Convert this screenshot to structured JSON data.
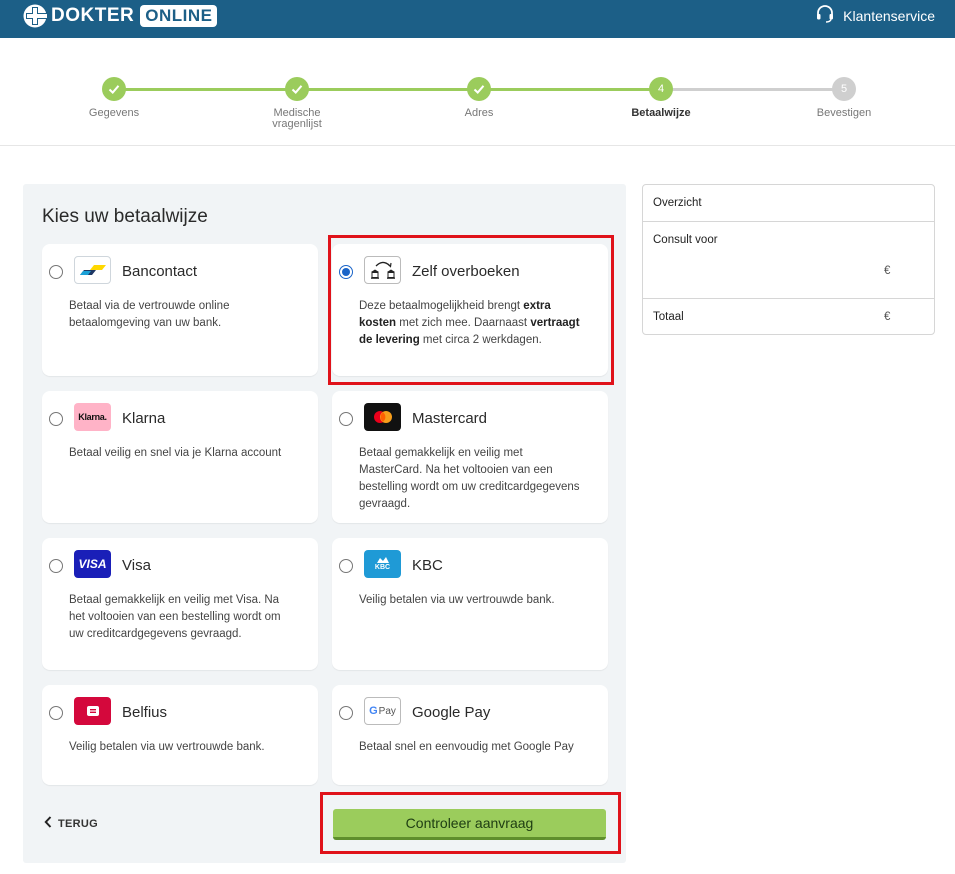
{
  "header": {
    "logo_part1": "DOKTER",
    "logo_part2": "ONLINE",
    "service_label": "Klantenservice"
  },
  "stepper": {
    "steps": [
      {
        "label": "Gegevens",
        "state": "done"
      },
      {
        "label": "Medische\nvragenlijst",
        "state": "done"
      },
      {
        "label": "Adres",
        "state": "done"
      },
      {
        "label": "Betaalwijze",
        "number": "4",
        "state": "active"
      },
      {
        "label": "Bevestigen",
        "number": "5",
        "state": "todo"
      }
    ],
    "colors": {
      "done": "#9bcc5c",
      "todo": "#cfcfcf"
    }
  },
  "payment": {
    "title": "Kies uw betaalwijze",
    "methods": [
      {
        "name": "Bancontact",
        "desc": "Betaal via de vertrouwde online betaalomgeving van uw bank.",
        "icon": "bancontact-logo",
        "selected": false
      },
      {
        "name": "Zelf overboeken",
        "desc_parts": [
          "Deze betaalmogelijkheid brengt ",
          "extra kosten",
          " met zich mee. Daarnaast ",
          "vertraagt de levering",
          " met circa 2 werkdagen."
        ],
        "icon": "bank-transfer-icon",
        "selected": true
      },
      {
        "name": "Klarna",
        "desc": "Betaal veilig en snel via je Klarna account",
        "icon": "klarna-logo",
        "logo_text": "Klarna.",
        "selected": false
      },
      {
        "name": "Mastercard",
        "desc": "Betaal gemakkelijk en veilig met MasterCard. Na het voltooien van een bestelling wordt om uw creditcardgegevens gevraagd.",
        "icon": "mastercard-logo",
        "selected": false
      },
      {
        "name": "Visa",
        "desc": "Betaal gemakkelijk en veilig met Visa. Na het voltooien van een bestelling wordt om uw creditcardgegevens gevraagd.",
        "icon": "visa-logo",
        "logo_text": "VISA",
        "selected": false
      },
      {
        "name": "KBC",
        "desc": "Veilig betalen via uw vertrouwde bank.",
        "icon": "kbc-logo",
        "logo_text": "KBC",
        "selected": false
      },
      {
        "name": "Belfius",
        "desc": "Veilig betalen via uw vertrouwde bank.",
        "icon": "belfius-logo",
        "selected": false
      },
      {
        "name": "Google Pay",
        "desc": "Betaal snel en eenvoudig met Google Pay",
        "icon": "google-pay-logo",
        "logo_text": "Pay",
        "selected": false
      }
    ],
    "back_label": "TERUG",
    "submit_label": "Controleer aanvraag"
  },
  "summary": {
    "title": "Overzicht",
    "consult_label": "Consult voor",
    "consult_value": "€",
    "total_label": "Totaal",
    "total_value": "€"
  },
  "colors": {
    "header_bg": "#1c5f87",
    "accent_green": "#9bcc5c",
    "highlight_red": "#e0121a",
    "radio_selected": "#1a64c8"
  }
}
